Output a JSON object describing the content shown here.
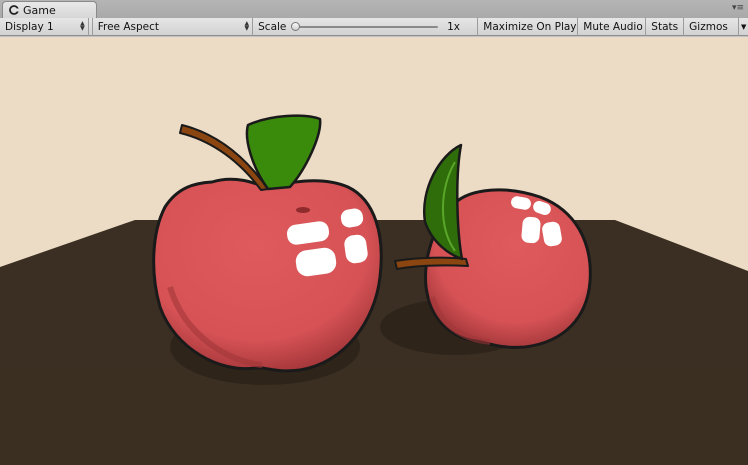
{
  "tab": {
    "title": "Game",
    "icon": "unity-logo-icon"
  },
  "toolbar": {
    "display": "Display 1",
    "aspect": "Free Aspect",
    "scale_label": "Scale",
    "scale_value": "1x",
    "scale_level": 1,
    "maximize": "Maximize On Play",
    "mute": "Mute Audio",
    "stats": "Stats",
    "gizmos": "Gizmos"
  },
  "colors": {
    "sky": "#ecdcc5",
    "table": "#3b2f22",
    "apple": "#d65255",
    "leaf": "#3a8a0c",
    "stem": "#8a4510"
  }
}
